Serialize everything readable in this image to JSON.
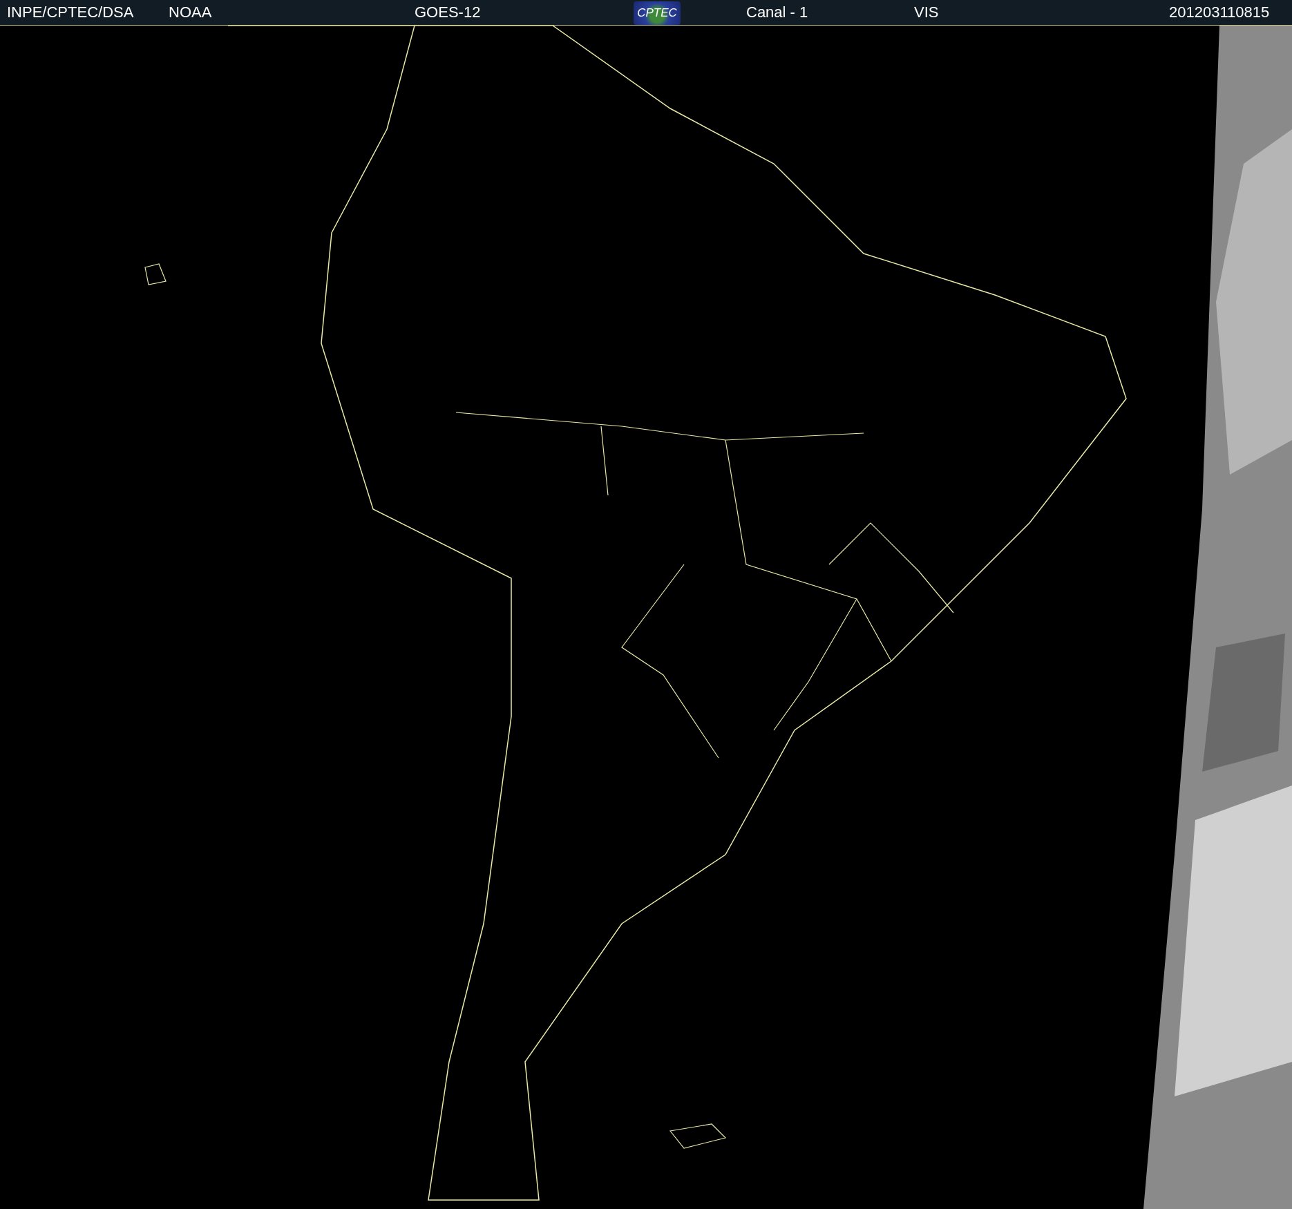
{
  "header": {
    "source": "INPE/CPTEC/DSA",
    "agency": "NOAA",
    "satellite": "GOES-12",
    "logo_text": "CPTEC",
    "channel": "Canal - 1",
    "band": "VIS",
    "timestamp": "201203110815"
  }
}
